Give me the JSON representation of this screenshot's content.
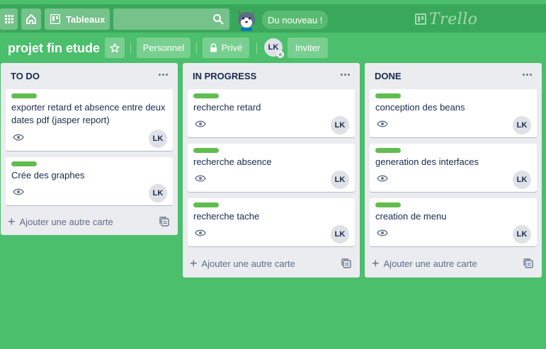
{
  "header": {
    "boards_label": "Tableaux",
    "search_placeholder": "",
    "news_label": "Du nouveau !",
    "logo_text": "Trello",
    "icons": [
      "apps-grid-icon",
      "home-icon",
      "boards-icon",
      "search-icon",
      "husky-mascot-icon"
    ]
  },
  "board": {
    "title": "projet fin etude",
    "personal_label": "Personnel",
    "private_label": "Privé",
    "invite_label": "Inviter",
    "member_initials": "LK",
    "icons": [
      "star-icon",
      "lock-icon",
      "admin-chevron-icon"
    ]
  },
  "lists": [
    {
      "title": "TO DO",
      "cards": [
        {
          "title": "exporter retard et absence entre deux dates pdf (jasper report)",
          "member": "LK"
        },
        {
          "title": "Crée des graphes",
          "member": "LK"
        }
      ],
      "add_label": "Ajouter une autre carte"
    },
    {
      "title": "IN PROGRESS",
      "cards": [
        {
          "title": "recherche retard",
          "member": "LK"
        },
        {
          "title": "recherche absence",
          "member": "LK"
        },
        {
          "title": "recherche tache",
          "member": "LK"
        }
      ],
      "add_label": "Ajouter une autre carte"
    },
    {
      "title": "DONE",
      "cards": [
        {
          "title": "conception des beans",
          "member": "LK"
        },
        {
          "title": "generation des interfaces",
          "member": "LK"
        },
        {
          "title": "creation de menu",
          "member": "LK"
        }
      ],
      "add_label": "Ajouter une autre carte"
    }
  ],
  "colors": {
    "board_background": "#4bbf6b",
    "header_background": "#3aa85a",
    "list_background": "#ebecf0",
    "label_green": "#61bd4f"
  }
}
